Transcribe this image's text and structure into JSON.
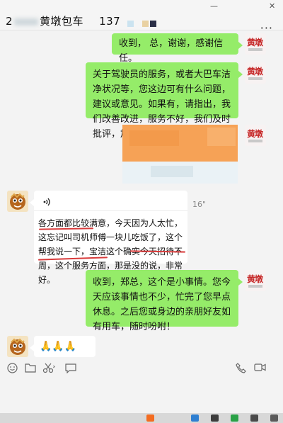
{
  "window": {
    "title_prefix": "2",
    "title_name": "黄墩包车",
    "member_count": "137",
    "minimize_label": "—",
    "close_label": "✕",
    "more_label": "···"
  },
  "messages": {
    "m1_text": "收到，   总，谢谢，感谢信任。",
    "m2_text": "关于驾驶员的服务，或者大巴车洁净状况等，您这边可有什么问题，建议或意见。如果有，请指出，我们改善改进，服务不好，我们及时批评，加强管理。",
    "voice_duration": "16\"",
    "transcript_text": "各方面都比较满意，今天因为人太忙，这忘记叫司机师傅一块儿吃饭了，这个帮我说一下，宝洁这个确实今天招待不周，这个服务方面，那是没的说，非常好。",
    "m4_text": "收到，郑总，这个是小事情。您今天应该事情也不少，忙完了您早点休息。之后您或身边的亲朋好友如有用车，随时吩咐！",
    "m5_emoji": "🙏🙏🙏"
  },
  "icons": {
    "voice": "voice-wave-icon",
    "emoji": "emoji-icon",
    "folder": "folder-icon",
    "scissors": "scissors-icon",
    "chat_history": "chat-history-icon",
    "phone": "phone-icon",
    "video": "video-icon"
  },
  "colors": {
    "green_bubble": "#95ec69",
    "white_bubble": "#ffffff",
    "background": "#f3f3f3",
    "annotation_red": "#d93b3b",
    "orange_image": "#f7a15a"
  }
}
